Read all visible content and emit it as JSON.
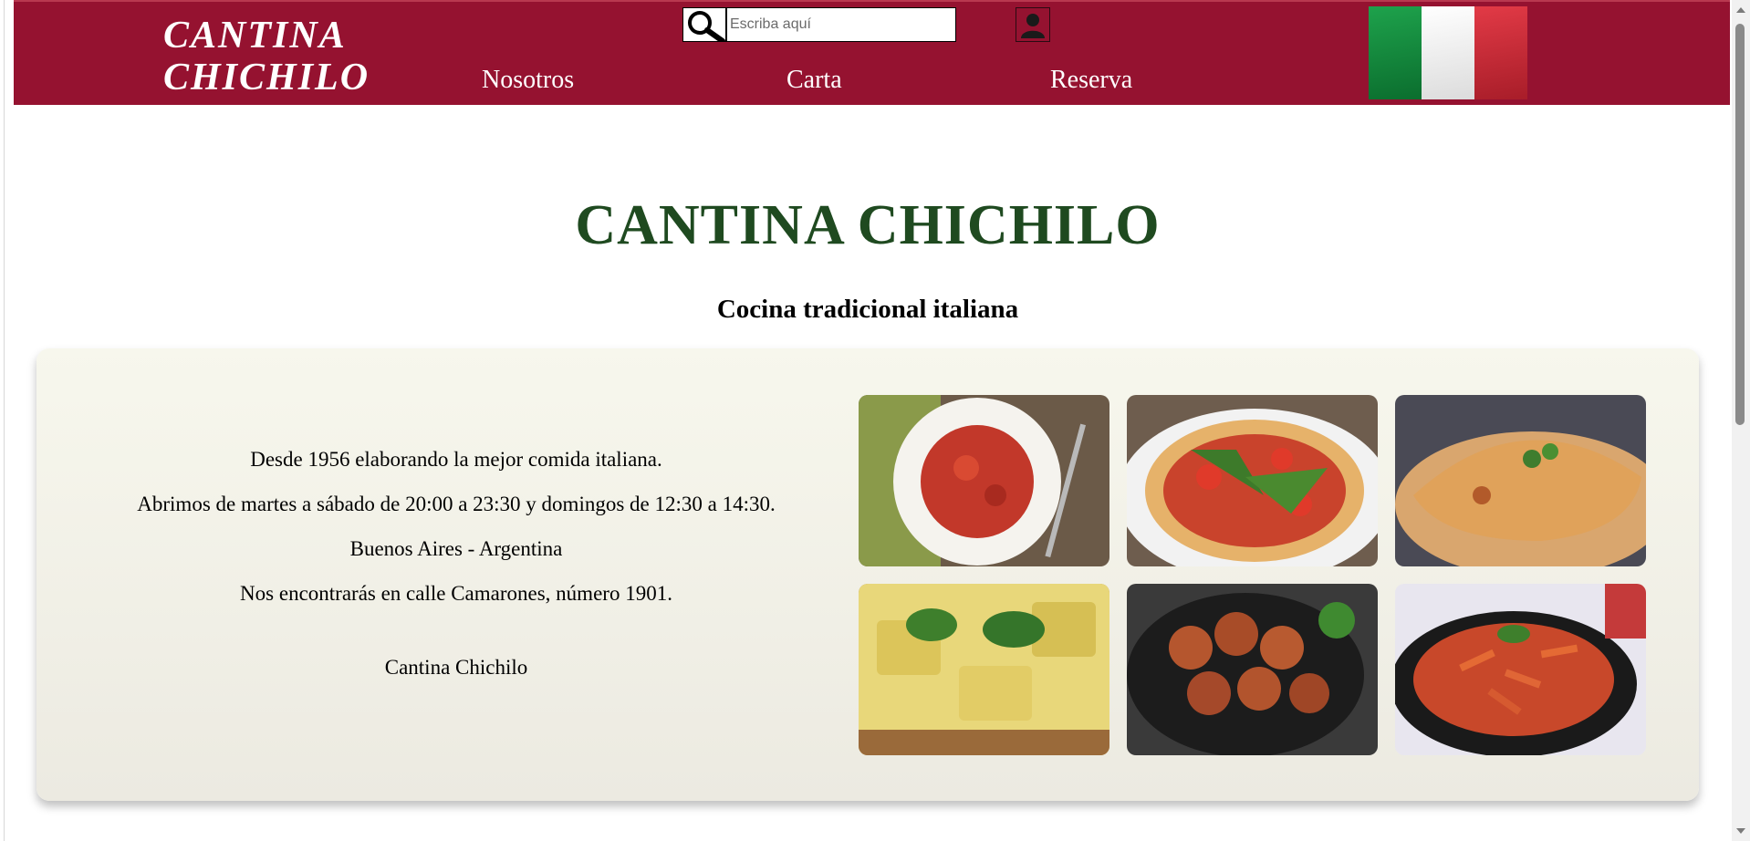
{
  "header": {
    "logo_line1": "CANTINA",
    "logo_line2": "CHICHILO",
    "search_placeholder": "Escriba aquí",
    "search_icon": "magnifier-icon",
    "user_icon": "user-icon",
    "nav": [
      {
        "label": "Nosotros"
      },
      {
        "label": "Carta"
      },
      {
        "label": "Reserva"
      }
    ],
    "flag": {
      "name": "italy-flag",
      "colors": [
        "#0f8a3c",
        "#f4f4f4",
        "#cf2b37"
      ]
    },
    "background": "#951230"
  },
  "hero": {
    "title": "CANTINA CHICHILO",
    "subtitle": "Cocina tradicional italiana",
    "title_color": "#1f4a20"
  },
  "info": {
    "since": "Desde 1956 elaborando la mejor comida italiana.",
    "hours": "Abrimos de martes a sábado de 20:00 a 23:30 y domingos de 12:30 a 14:30.",
    "location": "Buenos Aires - Argentina",
    "address": "Nos encontrarás en calle Camarones, número 1901.",
    "signature": "Cantina Chichilo"
  },
  "gallery": [
    {
      "name": "spaghetti-photo"
    },
    {
      "name": "pizza-arugula-photo"
    },
    {
      "name": "calzone-photo"
    },
    {
      "name": "ravioli-photo"
    },
    {
      "name": "meatballs-photo"
    },
    {
      "name": "penne-photo"
    }
  ]
}
